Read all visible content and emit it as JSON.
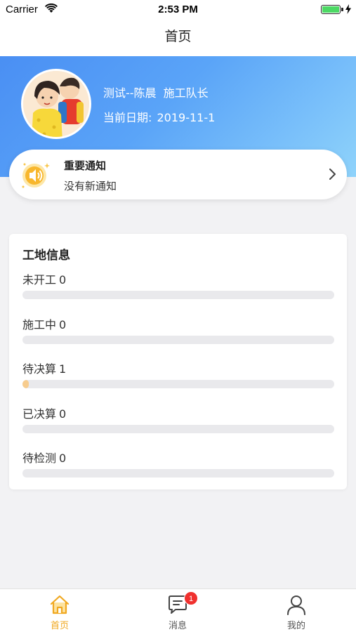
{
  "status_bar": {
    "carrier": "Carrier",
    "time": "2:53 PM",
    "battery_level": 1.0
  },
  "nav": {
    "title": "首页"
  },
  "profile": {
    "name": "测试--陈晨",
    "role": "施工队长",
    "date_label": "当前日期:",
    "date": "2019-11-1"
  },
  "notice": {
    "title": "重要通知",
    "text": "没有新通知"
  },
  "site_info": {
    "title": "工地信息",
    "stats": [
      {
        "label": "未开工",
        "count": "0",
        "progress": 0.0
      },
      {
        "label": "施工中",
        "count": "0",
        "progress": 0.0
      },
      {
        "label": "待决算",
        "count": "1",
        "progress": 0.02
      },
      {
        "label": "已决算",
        "count": "0",
        "progress": 0.0
      },
      {
        "label": "待检测",
        "count": "0",
        "progress": 0.0
      }
    ]
  },
  "tabs": [
    {
      "label": "首页",
      "icon": "home-icon",
      "active": true
    },
    {
      "label": "消息",
      "icon": "message-icon",
      "badge": "1"
    },
    {
      "label": "我的",
      "icon": "user-icon"
    }
  ],
  "colors": {
    "accent": "#f0a820",
    "hero_start": "#4a8ff3",
    "hero_end": "#8fd3fb",
    "progress_fill": "#f7cc8e",
    "badge": "#f0302e"
  }
}
